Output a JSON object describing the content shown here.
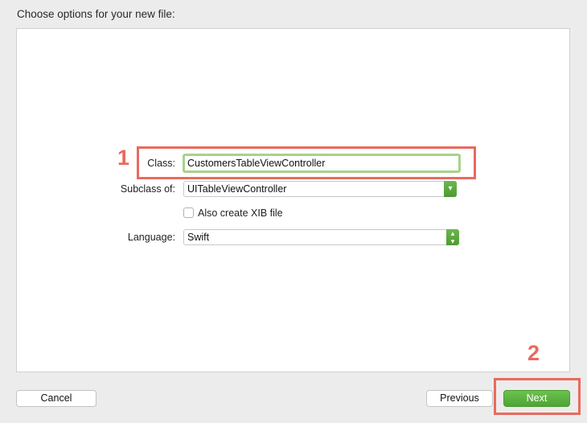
{
  "header": {
    "title": "Choose options for your new file:"
  },
  "form": {
    "class_label": "Class:",
    "class_value": "CustomersTableViewController",
    "subclass_label": "Subclass of:",
    "subclass_value": "UITableViewController",
    "xib_label": "Also create XIB file",
    "xib_checked": false,
    "language_label": "Language:",
    "language_value": "Swift"
  },
  "annotations": {
    "marker_1": "1",
    "marker_2": "2",
    "color": "#e96a5e"
  },
  "footer": {
    "cancel_label": "Cancel",
    "previous_label": "Previous",
    "next_label": "Next"
  },
  "colors": {
    "accent_green": "#5db141",
    "focus_ring": "#a6d38a"
  },
  "icons": {
    "subclass_dropdown": "chevron-down-icon",
    "language_dropdown": "updown-chevron-icon"
  }
}
